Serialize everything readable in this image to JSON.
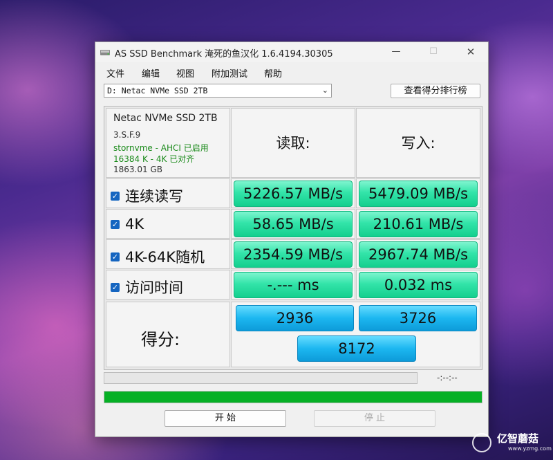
{
  "window": {
    "title": "AS SSD Benchmark 淹死的鱼汉化 1.6.4194.30305",
    "controls": {
      "minimize": "—",
      "maximize": "☐",
      "close": "✕"
    }
  },
  "menu": [
    "文件",
    "编辑",
    "视图",
    "附加测试",
    "帮助"
  ],
  "drive_select": {
    "value": "D: Netac NVMe SSD 2TB"
  },
  "rank_button": "查看得分排行榜",
  "drive_info": {
    "name": "Netac NVMe SSD 2TB",
    "firmware": "3.S.F.9",
    "driver": "stornvme - AHCI 已启用",
    "alignment": "16384 K - 4K 已对齐",
    "capacity": "1863.01 GB"
  },
  "headers": {
    "read": "读取:",
    "write": "写入:"
  },
  "rows": [
    {
      "label": "连续读写",
      "checked": true,
      "read": "5226.57 MB/s",
      "write": "5479.09 MB/s"
    },
    {
      "label": "4K",
      "checked": true,
      "read": "58.65 MB/s",
      "write": "210.61 MB/s"
    },
    {
      "label": "4K-64K随机",
      "checked": true,
      "read": "2354.59 MB/s",
      "write": "2967.74 MB/s"
    },
    {
      "label": "访问时间",
      "checked": true,
      "read": "-.--- ms",
      "write": "0.032 ms"
    }
  ],
  "score": {
    "label": "得分:",
    "read": "2936",
    "write": "3726",
    "total": "8172"
  },
  "progress": {
    "elapsed": "-:--:--",
    "completed_fraction": 1.0
  },
  "buttons": {
    "start": "开 始",
    "stop": "停 止"
  },
  "watermark": {
    "name": "亿智蘑菇",
    "url": "www.yzmg.com"
  },
  "colors": {
    "value_green": "#33e4a9",
    "score_blue": "#1cb7f0",
    "progress_green": "#06b025",
    "checkbox_blue": "#1565c0"
  }
}
